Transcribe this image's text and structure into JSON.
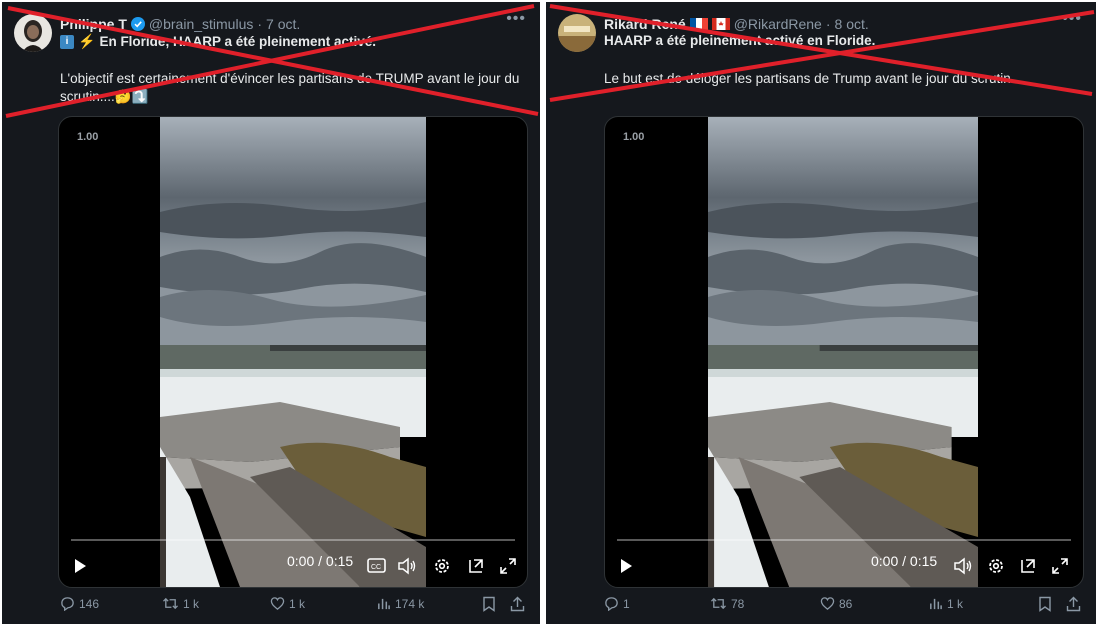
{
  "tweets": [
    {
      "name": "Philippe T",
      "handle": "@brain_stimulus",
      "sep": "·",
      "date": "7 oct.",
      "line1": "En Floride, HAARP a été pleinement activé.",
      "line2": "L'objectif est certainement d'évincer les partisans de TRUMP avant le jour du scrutin....🤔⤵️",
      "video": {
        "rate": "1.00",
        "time": "0:00 / 0:15"
      },
      "stats": {
        "replies": "146",
        "reposts": "1 k",
        "likes": "1 k",
        "views": "174 k"
      }
    },
    {
      "name": "Rikard René",
      "handle": "@RikardRene",
      "sep": "·",
      "date": "8 oct.",
      "line1": "HAARP a été pleinement activé en Floride.",
      "line2": "Le but est de déloger les partisans de Trump avant le jour du scrutin.",
      "video": {
        "rate": "1.00",
        "time": "0:00 / 0:15"
      },
      "stats": {
        "replies": "1",
        "reposts": "78",
        "likes": "86",
        "views": "1 k"
      }
    }
  ],
  "colors": {
    "background": "#15181d",
    "text": "#e7e9ea",
    "muted": "#8b98a5",
    "cross": "#e0202a",
    "verified": "#1d9bf0"
  },
  "icons": [
    "verified-badge-icon",
    "info-emoji-icon",
    "lightning-emoji-icon",
    "more-icon",
    "play-icon",
    "captions-icon",
    "volume-icon",
    "settings-icon",
    "popout-icon",
    "fullscreen-icon",
    "reply-icon",
    "repost-icon",
    "like-icon",
    "views-icon",
    "bookmark-icon",
    "share-icon",
    "flag-france-icon",
    "flag-canada-icon"
  ]
}
